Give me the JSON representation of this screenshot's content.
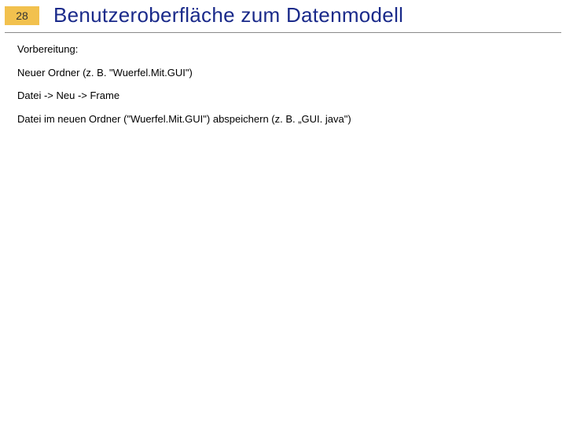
{
  "slide": {
    "number": "28",
    "title": "Benutzeroberfläche zum Datenmodell"
  },
  "body": {
    "lines": [
      "Vorbereitung:",
      "Neuer Ordner (z. B. \"Wuerfel.Mit.GUI\")",
      "Datei -> Neu -> Frame",
      "Datei im neuen Ordner (\"Wuerfel.Mit.GUI\") abspeichern (z. B. „GUI. java\")"
    ]
  }
}
